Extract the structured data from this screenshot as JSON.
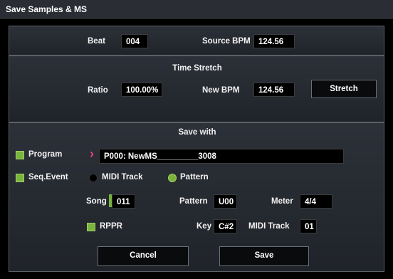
{
  "title": "Save Samples & MS",
  "beat": {
    "label": "Beat",
    "value": "004"
  },
  "source_bpm": {
    "label": "Source BPM",
    "value": "124.56"
  },
  "time_stretch": {
    "heading": "Time Stretch",
    "ratio_label": "Ratio",
    "ratio_value": "100.00%",
    "new_bpm_label": "New BPM",
    "new_bpm_value": "124.56",
    "stretch_button": "Stretch"
  },
  "save_with": {
    "heading": "Save with",
    "program_label": "Program",
    "program_arrow": "›",
    "program_value": "P000: NewMS_________3008",
    "seq_event_label": "Seq.Event",
    "midi_track_option": "MIDI Track",
    "pattern_option": "Pattern",
    "song_label": "Song",
    "song_value": "011",
    "pattern_label": "Pattern",
    "pattern_value": "U00",
    "meter_label": "Meter",
    "meter_value": "4/4",
    "rppr_label": "RPPR",
    "key_label": "Key",
    "key_value": "C#2",
    "midi_track_label": "MIDI Track",
    "midi_track_value": "01"
  },
  "buttons": {
    "cancel": "Cancel",
    "save": "Save"
  },
  "colors": {
    "accent_green": "#79b43c",
    "panel_border": "#5b6068",
    "field_bg": "#000000"
  }
}
